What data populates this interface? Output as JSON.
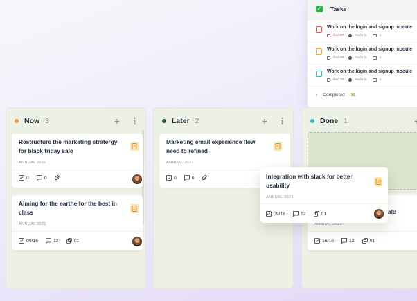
{
  "tasks_panel": {
    "title": "Tasks",
    "items": [
      {
        "title": "Work on the login and signup module",
        "date": "Dec 07",
        "assignee": "Kevin G.",
        "comments": "1",
        "color": "#e05353",
        "date_color": "#e05353"
      },
      {
        "title": "Work on the login and signup module",
        "date": "Dec 10",
        "assignee": "Kevin G.",
        "comments": "1",
        "color": "#f2a53a",
        "date_color": "#6b7280"
      },
      {
        "title": "Work on the login and signup module",
        "date": "Dec 10",
        "assignee": "Kevin G.",
        "comments": "1",
        "color": "#30b8b0",
        "date_color": "#6b7280"
      }
    ],
    "completed_label": "Completed",
    "completed_count": "01"
  },
  "columns": [
    {
      "title": "Now",
      "count": "3",
      "dot_color": "#f29a3a"
    },
    {
      "title": "Later",
      "count": "2",
      "dot_color": "#1f4d3a"
    },
    {
      "title": "Done",
      "count": "1",
      "dot_color": "#2bbfb5"
    }
  ],
  "cards": {
    "now_1": {
      "title": "Restructure the marketing stratergy for black friday sale",
      "subtitle": "ANNUAL 2021",
      "checks": "0",
      "comments": "0"
    },
    "now_2": {
      "title": "Aiming for the earthe for the best in class",
      "subtitle": "ANNUAL 2021",
      "checks": "09/16",
      "comments": "12",
      "links": "01"
    },
    "later_1": {
      "title": "Marketing email experience flow need to refined",
      "subtitle": "ANNUAL 2021",
      "checks": "0",
      "comments": "0"
    },
    "done_1": {
      "title_partial": "ale",
      "subtitle_partial": "ANNUAL 2021",
      "checks": "16/16",
      "comments": "12",
      "links": "01"
    },
    "dragging": {
      "title": "Integration with slack for better usability",
      "subtitle": "ANNUAL 2021",
      "checks": "09/16",
      "comments": "12",
      "links": "01"
    }
  },
  "icons": {
    "doc": "document-icon",
    "check": "checkbox-icon",
    "comment": "comment-icon",
    "attach-off": "no-attachment-icon",
    "link": "copy-link-icon"
  }
}
